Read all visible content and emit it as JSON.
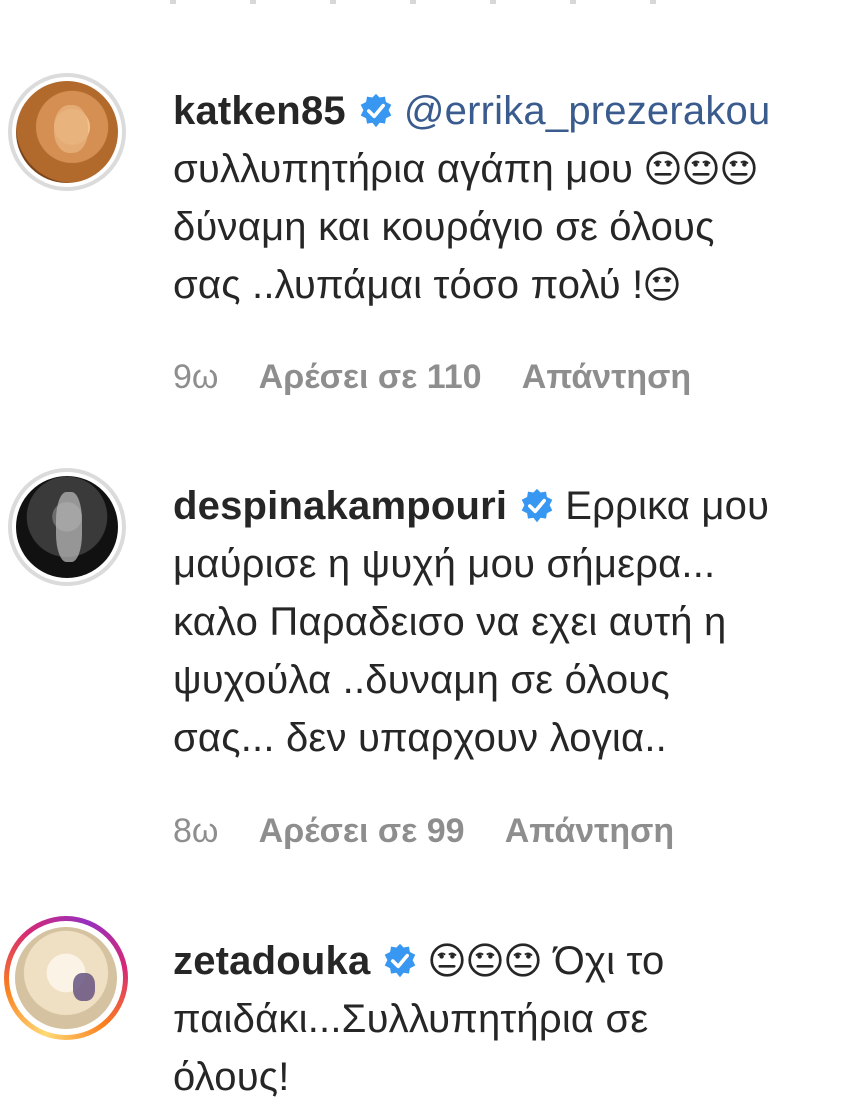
{
  "comments": [
    {
      "username": "katken85",
      "mention": "@errika_prezerakou",
      "text_lines": [
        "συλλυπητήρια αγάπη μου",
        "δύναμη και κουράγιο σε όλους",
        "σας ..λυπάμαι τόσο πολύ !"
      ],
      "time": "9ω",
      "likes": "Αρέσει σε 110",
      "reply": "Απάντηση"
    },
    {
      "username": "despinakampouri",
      "first_line_text": "Ερρικα μου",
      "text_lines": [
        "μαύρισε η ψυχή μου σήμερα...",
        "καλο Παραδεισο να εχει αυτή η",
        "ψυχούλα ..δυναμη σε όλους",
        "σας... δεν υπαρχουν λογια.."
      ],
      "time": "8ω",
      "likes": "Αρέσει σε 99",
      "reply": "Απάντηση"
    },
    {
      "username": "zetadouka",
      "first_line_text": "Όχι το",
      "text_lines": [
        "παιδάκι...Συλλυπητήρια σε",
        "όλους!"
      ]
    }
  ],
  "colors": {
    "verified": "#3897f0",
    "mention": "#3a5b8e",
    "meta": "#8e8e8e",
    "text": "#262626"
  },
  "icons": {
    "verified": "verified-badge-icon",
    "emoji": "neutral-face-emoji-icon"
  }
}
